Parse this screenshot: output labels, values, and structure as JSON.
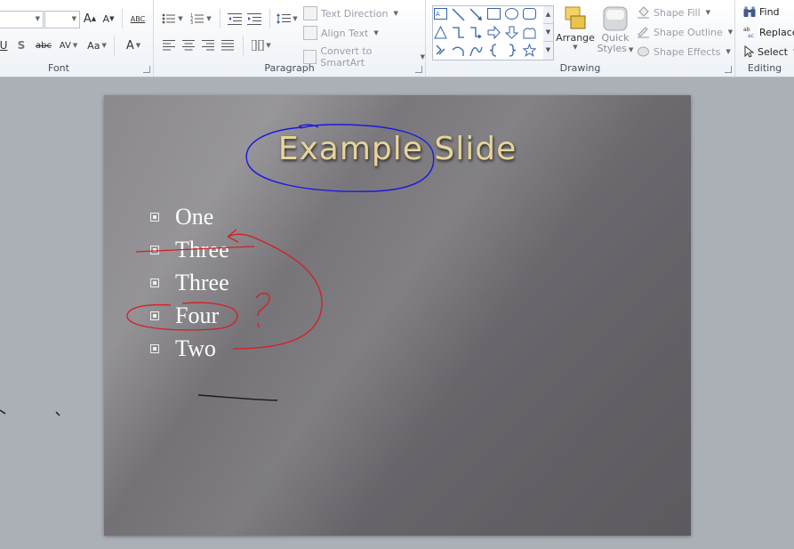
{
  "ribbon": {
    "font": {
      "label": "Font",
      "grow": "A",
      "shrink": "A",
      "clear": "ABC",
      "strike": "abc",
      "spacing": "AV",
      "case": "Aa",
      "color": "A",
      "shadow": "S"
    },
    "paragraph": {
      "label": "Paragraph",
      "text_direction": "Text Direction",
      "align_text": "Align Text",
      "convert_smartart": "Convert to SmartArt"
    },
    "drawing": {
      "label": "Drawing",
      "arrange": "Arrange",
      "quick_styles_1": "Quick",
      "quick_styles_2": "Styles",
      "shape_fill": "Shape Fill",
      "shape_outline": "Shape Outline",
      "shape_effects": "Shape Effects"
    },
    "editing": {
      "label": "Editing",
      "find": "Find",
      "replace": "Replace",
      "select": "Select"
    }
  },
  "slide": {
    "title": "Example Slide",
    "bullets": [
      "One",
      "Three",
      "Three",
      "Four",
      "Two"
    ]
  },
  "colors": {
    "ink_blue": "#1a1adf",
    "ink_red": "#d41f24",
    "ink_black": "#1a1a1a",
    "title_gold": "#e8d49a"
  }
}
